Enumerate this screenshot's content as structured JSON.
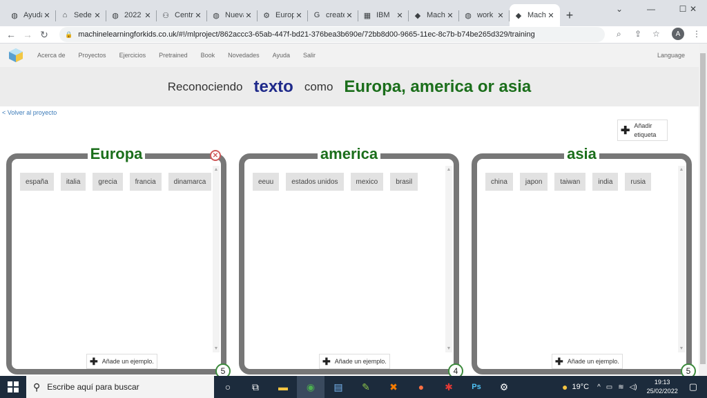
{
  "browser": {
    "tabs": [
      {
        "label": "Ayuda",
        "icon": "globe-icon",
        "active": false
      },
      {
        "label": "Sede",
        "icon": "bank-icon",
        "active": false
      },
      {
        "label": "2022",
        "icon": "globe-icon",
        "active": false
      },
      {
        "label": "Centro",
        "icon": "school-icon",
        "active": false
      },
      {
        "label": "Nueva",
        "icon": "globe-icon",
        "active": false
      },
      {
        "label": "Europa",
        "icon": "gear-icon",
        "active": false
      },
      {
        "label": "create",
        "icon": "google-icon",
        "active": false
      },
      {
        "label": "IBM",
        "icon": "ibm-icon",
        "active": false
      },
      {
        "label": "Mach",
        "icon": "mlkids-icon",
        "active": false
      },
      {
        "label": "work",
        "icon": "globe-icon",
        "active": false
      },
      {
        "label": "Mach",
        "icon": "mlkids-icon",
        "active": true
      }
    ],
    "url": "machinelearningforkids.co.uk/#!/mlproject/862accc3-65ab-447f-bd21-376bea3b690e/72bb8d00-9665-11ec-8c7b-b74be265d329/training",
    "profile_initial": "A"
  },
  "nav": {
    "links": [
      "Acerca de",
      "Proyectos",
      "Ejercicios",
      "Pretrained",
      "Book",
      "Novedades",
      "Ayuda",
      "Salir"
    ],
    "language": "Language"
  },
  "title": {
    "prefix": "Reconociendo",
    "type": "texto",
    "middle": "como",
    "labels": "Europa, america or asia"
  },
  "back_link": "< Volver al proyecto",
  "add_label": {
    "line1": "Añadir",
    "line2": "etiqueta"
  },
  "buckets": [
    {
      "name": "Europa",
      "items": [
        "españa",
        "italia",
        "grecia",
        "francia",
        "dinamarca"
      ],
      "count": "5",
      "add_example": "Añade un ejemplo."
    },
    {
      "name": "america",
      "items": [
        "eeuu",
        "estados unidos",
        "mexico",
        "brasil"
      ],
      "count": "4",
      "add_example": "Añade un ejemplo."
    },
    {
      "name": "asia",
      "items": [
        "china",
        "japon",
        "taiwan",
        "india",
        "rusia"
      ],
      "count": "5",
      "add_example": "Añade un ejemplo."
    }
  ],
  "taskbar": {
    "search_placeholder": "Escribe aquí para buscar",
    "temperature": "19°C",
    "time": "19:13",
    "date": "25/02/2022"
  }
}
